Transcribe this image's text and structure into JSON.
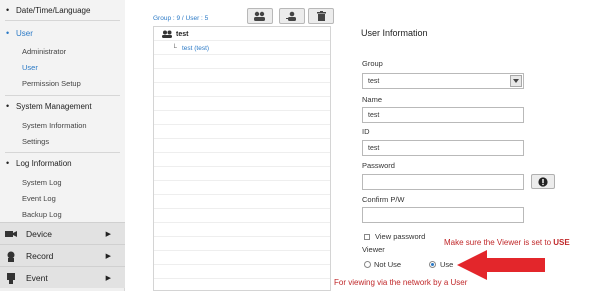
{
  "sidebar": {
    "date_time": "Date/Time/Language",
    "user": "User",
    "user_sub": [
      "Administrator",
      "User",
      "Permission Setup"
    ],
    "system_mgmt": "System Management",
    "system_sub": [
      "System Information",
      "Settings"
    ],
    "log_info": "Log Information",
    "log_sub": [
      "System Log",
      "Event Log",
      "Backup Log"
    ],
    "bottom": [
      {
        "label": "Device",
        "icon": "camera-icon"
      },
      {
        "label": "Record",
        "icon": "record-icon"
      },
      {
        "label": "Event",
        "icon": "event-icon"
      }
    ]
  },
  "tree": {
    "group_info": "Group : 9 / User : 5",
    "group_name": "test",
    "user_name": "test (test)"
  },
  "form": {
    "title": "User Information",
    "group_label": "Group",
    "group_value": "test",
    "name_label": "Name",
    "name_value": "test",
    "id_label": "ID",
    "id_value": "test",
    "password_label": "Password",
    "confirm_label": "Confirm P/W",
    "view_password": "View password",
    "viewer_label": "Viewer",
    "not_use": "Not Use",
    "use": "Use"
  },
  "annotations": {
    "note_pre": "Make sure the Viewer is set to ",
    "note_bold": "USE",
    "bottom_note": "For viewing via the network by a User"
  },
  "colors": {
    "accent": "#2a79c6",
    "annotation": "#c0282a",
    "arrow": "#e3262b"
  }
}
